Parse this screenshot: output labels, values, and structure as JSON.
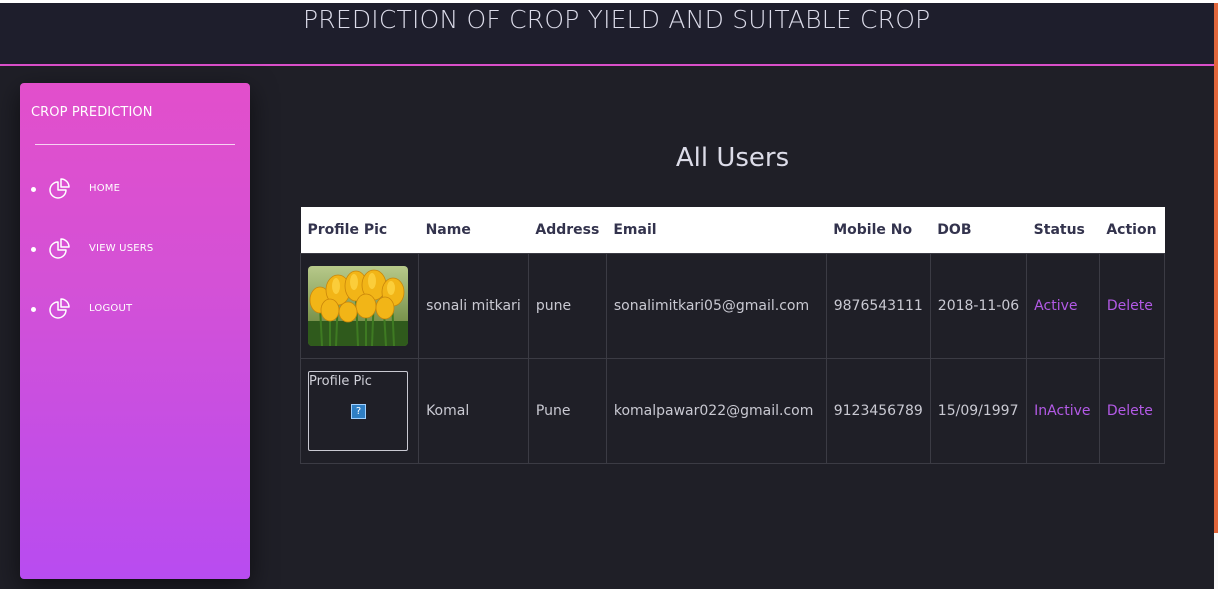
{
  "header": {
    "title": "PREDICTION OF CROP YIELD AND SUITABLE CROP"
  },
  "sidebar": {
    "brand": "CROP PREDICTION",
    "items": [
      {
        "label": "HOME",
        "icon": "pie-chart-icon"
      },
      {
        "label": "VIEW USERS",
        "icon": "pie-chart-icon"
      },
      {
        "label": "LOGOUT",
        "icon": "pie-chart-icon"
      }
    ]
  },
  "main": {
    "heading": "All Users",
    "table": {
      "columns": [
        "Profile Pic",
        "Name",
        "Address",
        "Email",
        "Mobile No",
        "DOB",
        "Status",
        "Action"
      ],
      "rows": [
        {
          "image": "tulips-photo",
          "name": "sonali mitkari",
          "address": "pune",
          "email": "sonalimitkari05@gmail.com",
          "mobile": "9876543111",
          "dob": "2018-11-06",
          "status": "Active",
          "action": "Delete"
        },
        {
          "image_alt": "Profile Pic",
          "broken_icon": "?",
          "name": "Komal",
          "address": "Pune",
          "email": "komalpawar022@gmail.com",
          "mobile": "9123456789",
          "dob": "15/09/1997",
          "status": "InActive",
          "action": "Delete"
        }
      ]
    }
  },
  "colors": {
    "background": "#1f1f27",
    "header_border": "#d94fc9",
    "sidebar_top": "#e24fcb",
    "sidebar_bottom": "#b84cf0",
    "link": "#b35ae6"
  }
}
